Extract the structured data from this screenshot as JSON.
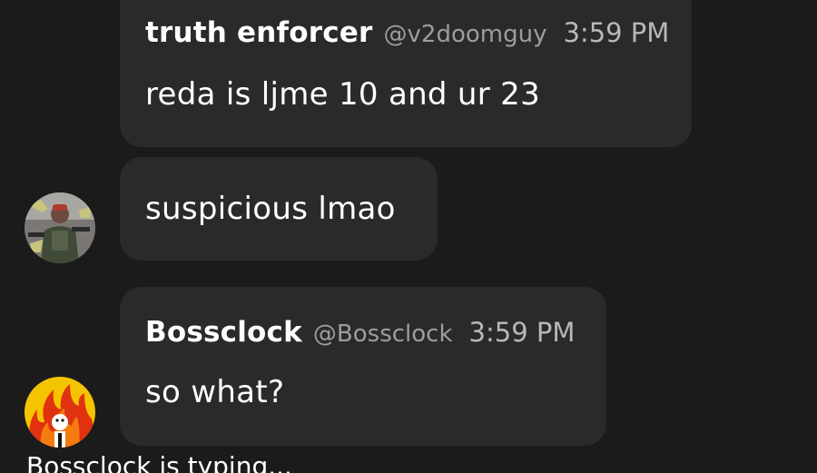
{
  "messages": [
    {
      "author": "truth enforcer",
      "handle": "@v2doomguy",
      "time": "3:59 PM",
      "text": "reda is ljme 10 and ur 23"
    },
    {
      "text": "suspicious lmao",
      "avatar_icon": "soldier-avatar-icon"
    },
    {
      "author": "Bossclock",
      "handle": "@Bossclock",
      "time": "3:59 PM",
      "text": "so what?",
      "avatar_icon": "fire-avatar-icon"
    }
  ],
  "typing_indicator": "Bossclock is typing..."
}
